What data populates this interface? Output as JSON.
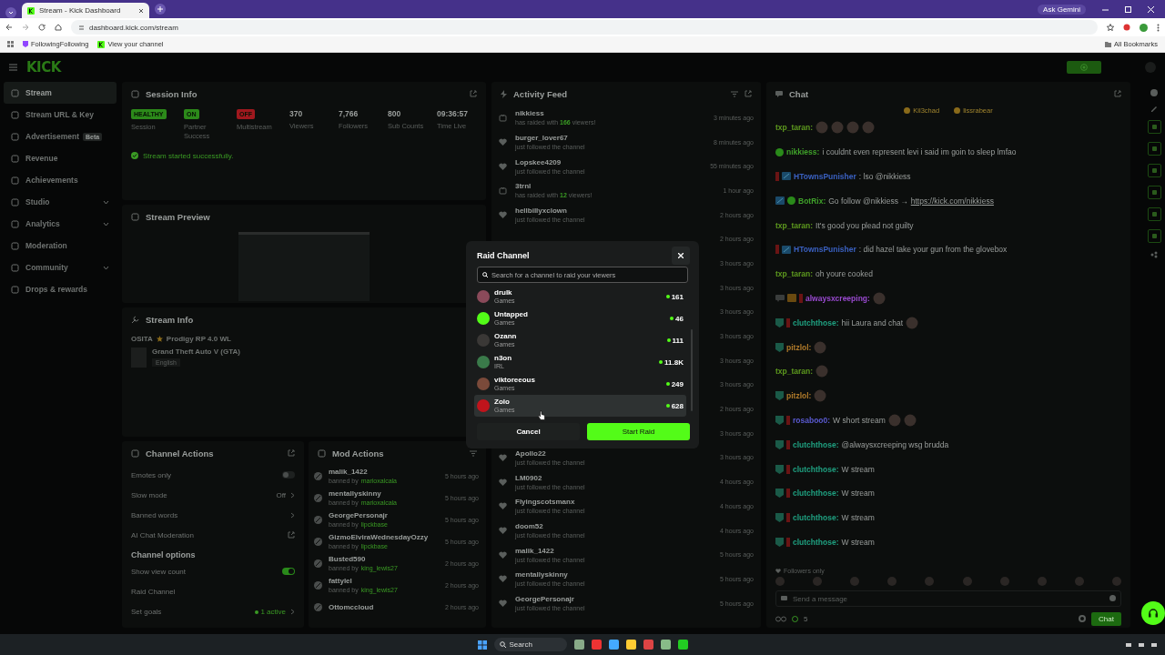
{
  "browser": {
    "tab_title": "Stream - Kick Dashboard",
    "url": "dashboard.kick.com/stream",
    "bookmarks": [
      "FollowingFollowing",
      "View your channel"
    ],
    "all_bookmarks": "All Bookmarks",
    "gemini": "Ask Gemini"
  },
  "header": {
    "logo": "KICK"
  },
  "sidebar": {
    "items": [
      {
        "label": "Stream",
        "selected": true,
        "expandable": false
      },
      {
        "label": "Stream URL & Key",
        "selected": false,
        "expandable": false
      },
      {
        "label": "Advertisement",
        "badge": "Beta",
        "selected": false,
        "expandable": false
      },
      {
        "label": "Revenue",
        "selected": false,
        "expandable": false
      },
      {
        "label": "Achievements",
        "selected": false,
        "expandable": false
      },
      {
        "label": "Studio",
        "selected": false,
        "expandable": true
      },
      {
        "label": "Analytics",
        "selected": false,
        "expandable": true
      },
      {
        "label": "Moderation",
        "selected": false,
        "expandable": false
      },
      {
        "label": "Community",
        "selected": false,
        "expandable": true
      },
      {
        "label": "Drops & rewards",
        "selected": false,
        "expandable": false
      }
    ]
  },
  "session_info": {
    "title": "Session Info",
    "stats": [
      {
        "kind": "badge",
        "value": "HEALTHY",
        "color": "#2c8a1a",
        "label": "Session"
      },
      {
        "kind": "badge",
        "value": "ON",
        "color": "#2c8a1a",
        "label": "Partner Success"
      },
      {
        "kind": "badge",
        "value": "OFF",
        "color": "#a0181e",
        "label": "Multistream"
      },
      {
        "kind": "number",
        "value": "370",
        "label": "Viewers"
      },
      {
        "kind": "number",
        "value": "7,766",
        "label": "Followers"
      },
      {
        "kind": "number",
        "value": "800",
        "label": "Sub Counts"
      },
      {
        "kind": "number",
        "value": "09:36:57",
        "label": "Time Live"
      }
    ],
    "status": "Stream started successfully."
  },
  "stream_preview": {
    "title": "Stream Preview"
  },
  "stream_info": {
    "title": "Stream Info",
    "streamer_tag": "OSITA",
    "stream_title": "Prodigy RP 4.0 WL",
    "category": "Grand Theft Auto V (GTA)",
    "tags": [
      "English"
    ]
  },
  "channel_actions": {
    "title": "Channel Actions",
    "rows": [
      {
        "kind": "toggle",
        "label": "Emotes only",
        "on": false
      },
      {
        "kind": "link",
        "label": "Slow mode",
        "value": "Off"
      },
      {
        "kind": "link",
        "label": "Banned words"
      },
      {
        "kind": "external",
        "label": "AI Chat Moderation"
      }
    ],
    "options_title": "Channel options",
    "options": [
      {
        "kind": "toggle",
        "label": "Show view count",
        "on": true
      },
      {
        "kind": "plain",
        "label": "Raid Channel"
      },
      {
        "kind": "link",
        "label": "Set goals",
        "value": "1 active"
      }
    ]
  },
  "mod_actions": {
    "title": "Mod Actions",
    "items": [
      {
        "user": "malik_1422",
        "action": "banned by",
        "moderator": "marioxalcala",
        "time": "5 hours ago"
      },
      {
        "user": "mentallyskinny",
        "action": "banned by",
        "moderator": "marioxalcala",
        "time": "5 hours ago"
      },
      {
        "user": "GeorgePersonajr",
        "action": "banned by",
        "moderator": "lipckbase",
        "time": "5 hours ago"
      },
      {
        "user": "GizmoElviraWednesdayOzzy",
        "action": "banned by",
        "moderator": "lipckbase",
        "time": "5 hours ago"
      },
      {
        "user": "Busted590",
        "action": "banned by",
        "moderator": "king_lewis27",
        "time": "2 hours ago"
      },
      {
        "user": "fattylel",
        "action": "banned by",
        "moderator": "king_lewis27",
        "time": "2 hours ago"
      },
      {
        "user": "Ottomccloud",
        "time": "2 hours ago"
      }
    ]
  },
  "activity_feed": {
    "title": "Activity Feed",
    "items": [
      {
        "kind": "raid",
        "user": "nikkiess",
        "detail": "has raided with **166** viewers!",
        "time": "3 minutes ago"
      },
      {
        "kind": "follow",
        "user": "burger_lover67",
        "detail": "just followed the channel",
        "time": "8 minutes ago"
      },
      {
        "kind": "follow",
        "user": "Lopskee4209",
        "detail": "just followed the channel",
        "time": "55 minutes ago"
      },
      {
        "kind": "raid",
        "user": "3trnl",
        "detail": "has raided with **12** viewers!",
        "time": "1 hour ago"
      },
      {
        "kind": "follow",
        "user": "hellbillyxclown",
        "detail": "just followed the channel",
        "time": "2 hours ago"
      },
      {
        "kind": "covered",
        "time": "2 hours ago"
      },
      {
        "kind": "covered",
        "time": "3 hours ago"
      },
      {
        "kind": "covered",
        "time": "3 hours ago"
      },
      {
        "kind": "covered",
        "time": "3 hours ago"
      },
      {
        "kind": "covered",
        "time": "3 hours ago"
      },
      {
        "kind": "covered",
        "time": "3 hours ago"
      },
      {
        "kind": "covered",
        "time": "3 hours ago"
      },
      {
        "kind": "covered",
        "time": "2 hours ago"
      },
      {
        "kind": "covered",
        "time": "3 hours ago"
      },
      {
        "kind": "follow",
        "user": "Apollo22",
        "detail": "just followed the channel",
        "time": "3 hours ago"
      },
      {
        "kind": "follow",
        "user": "LM0902",
        "detail": "just followed the channel",
        "time": "4 hours ago"
      },
      {
        "kind": "follow",
        "user": "Flyingscotsmanx",
        "detail": "just followed the channel",
        "time": "4 hours ago"
      },
      {
        "kind": "follow",
        "user": "doom52",
        "detail": "just followed the channel",
        "time": "4 hours ago"
      },
      {
        "kind": "follow",
        "user": "malik_1422",
        "detail": "just followed the channel",
        "time": "5 hours ago"
      },
      {
        "kind": "follow",
        "user": "mentallyskinny",
        "detail": "just followed the channel",
        "time": "5 hours ago"
      },
      {
        "kind": "follow",
        "user": "GeorgePersonajr",
        "detail": "just followed the channel",
        "time": "5 hours ago"
      }
    ]
  },
  "chat": {
    "title": "Chat",
    "pinned": [
      "Kil3chad",
      "lissrabear"
    ],
    "messages": [
      {
        "user": "txp_taran:",
        "color": "#5e9a1e",
        "emotes": [
          {
            "kind": "face"
          },
          {
            "kind": "face"
          },
          {
            "kind": "face"
          },
          {
            "kind": "face"
          }
        ]
      },
      {
        "user": "nikkiess:",
        "color": "#3fa02a",
        "badges": [
          {
            "kind": "verified"
          }
        ],
        "text": "i couldnt even represent levi i said im goin to sleep lmfao"
      },
      {
        "user": "HTownsPunisher",
        "color": "#3a60c0",
        "badges": [
          {
            "kind": "gift"
          },
          {
            "kind": "mod"
          }
        ],
        "text": ": lso @nikkiess"
      },
      {
        "user": "BotRix:",
        "color": "#3fa02a",
        "badges": [
          {
            "kind": "mod"
          },
          {
            "kind": "verified"
          }
        ],
        "text": "Go follow @nikkiess →",
        "link": "https://kick.com/nikkiess"
      },
      {
        "user": "txp_taran:",
        "color": "#5e9a1e",
        "text": "It's good you plead not guilty"
      },
      {
        "user": "HTownsPunisher",
        "color": "#3a60c0",
        "badges": [
          {
            "kind": "gift"
          },
          {
            "kind": "mod"
          }
        ],
        "text": ": did hazel take your gun from the glovebox"
      },
      {
        "user": "txp_taran:",
        "color": "#5e9a1e",
        "text": "oh youre cooked"
      },
      {
        "user": "alwaysxcreeping:",
        "color": "#9a4ad0",
        "badges": [
          {
            "kind": "chat"
          },
          {
            "kind": "crown"
          },
          {
            "kind": "gift"
          }
        ],
        "emotes": [
          {
            "kind": "face"
          }
        ]
      },
      {
        "user": "clutchthose:",
        "color": "#1fa080",
        "badges": [
          {
            "kind": "sub"
          },
          {
            "kind": "gift"
          }
        ],
        "text": "hii Laura and chat",
        "emotes": [
          {
            "kind": "face"
          }
        ]
      },
      {
        "user": "pitzlol:",
        "color": "#b07a2a",
        "badges": [
          {
            "kind": "sub"
          }
        ],
        "emotes": [
          {
            "kind": "face"
          }
        ]
      },
      {
        "user": "txp_taran:",
        "color": "#5e9a1e",
        "emotes": [
          {
            "kind": "face"
          }
        ]
      },
      {
        "user": "pitzlol:",
        "color": "#b07a2a",
        "badges": [
          {
            "kind": "sub"
          }
        ],
        "emotes": [
          {
            "kind": "face"
          }
        ]
      },
      {
        "user": "rosaboo0:",
        "color": "#5a5ad0",
        "badges": [
          {
            "kind": "sub"
          },
          {
            "kind": "gift"
          }
        ],
        "text": "W short stream",
        "emotes": [
          {
            "kind": "face"
          },
          {
            "kind": "face"
          }
        ]
      },
      {
        "user": "clutchthose:",
        "color": "#1fa080",
        "badges": [
          {
            "kind": "sub"
          },
          {
            "kind": "gift"
          }
        ],
        "text": "@alwaysxcreeping wsg brudda"
      },
      {
        "user": "clutchthose:",
        "color": "#1fa080",
        "badges": [
          {
            "kind": "sub"
          },
          {
            "kind": "gift"
          }
        ],
        "text": "W stream"
      },
      {
        "user": "clutchthose:",
        "color": "#1fa080",
        "badges": [
          {
            "kind": "sub"
          },
          {
            "kind": "gift"
          }
        ],
        "text": "W stream"
      },
      {
        "user": "clutchthose:",
        "color": "#1fa080",
        "badges": [
          {
            "kind": "sub"
          },
          {
            "kind": "gift"
          }
        ],
        "text": "W stream"
      },
      {
        "user": "clutchthose:",
        "color": "#1fa080",
        "badges": [
          {
            "kind": "sub"
          },
          {
            "kind": "gift"
          }
        ],
        "text": "W stream"
      }
    ],
    "followers_only": "Followers only",
    "input_placeholder": "Send a message",
    "viewer_count": "5",
    "send": "Chat"
  },
  "raid_modal": {
    "title": "Raid Channel",
    "search_placeholder": "Search for a channel to raid your viewers",
    "channels": [
      {
        "name": "drulk",
        "category": "Games",
        "viewers": "161",
        "color": "#8a4a5a",
        "highlighted": false
      },
      {
        "name": "Untapped",
        "category": "Games",
        "viewers": "46",
        "color": "#53fc18",
        "highlighted": false
      },
      {
        "name": "Ozann",
        "category": "Games",
        "viewers": "111",
        "color": "#3a3836",
        "highlighted": false
      },
      {
        "name": "n3on",
        "category": "IRL",
        "viewers": "11.8K",
        "color": "#3a7a4a",
        "highlighted": false
      },
      {
        "name": "viktoreeous",
        "category": "Games",
        "viewers": "249",
        "color": "#7a4a3a",
        "highlighted": false
      },
      {
        "name": "Zolo",
        "category": "Games",
        "viewers": "628",
        "color": "#c0141c",
        "highlighted": true
      }
    ],
    "cancel": "Cancel",
    "confirm": "Start Raid"
  },
  "taskbar": {
    "search": "Search"
  }
}
